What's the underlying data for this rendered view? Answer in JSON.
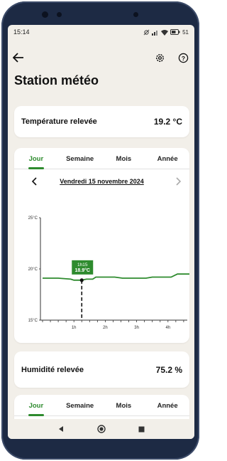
{
  "status_bar": {
    "time": "15:14",
    "battery": "51"
  },
  "page": {
    "title": "Station météo"
  },
  "temperature": {
    "label": "Température relevée",
    "value": "19.2 °C"
  },
  "tabs": [
    "Jour",
    "Semaine",
    "Mois",
    "Année"
  ],
  "active_tab": "Jour",
  "date_nav": {
    "date": "Vendredi 15 novembre 2024"
  },
  "chart_data": {
    "type": "line",
    "ylim": [
      15,
      25
    ],
    "yticks": [
      "25°C",
      "20°C",
      "15°C"
    ],
    "xticks": [
      "1h",
      "2h",
      "3h",
      "4h"
    ],
    "x_hours": [
      0,
      0.5,
      0.9,
      1.0,
      1.25,
      1.4,
      1.6,
      1.7,
      2.0,
      2.3,
      2.55,
      2.7,
      3.0,
      3.3,
      3.5,
      3.6,
      3.9,
      4.1,
      4.3,
      4.4,
      4.7,
      4.9
    ],
    "values": [
      19.1,
      19.1,
      19.0,
      18.9,
      18.9,
      19.0,
      19.0,
      19.2,
      19.2,
      19.2,
      19.1,
      19.1,
      19.1,
      19.1,
      19.2,
      19.2,
      19.2,
      19.2,
      19.5,
      19.5,
      19.5,
      19.3
    ],
    "series_color": "#2e8b2e",
    "marker": {
      "time": "1h15",
      "value": "18.9°C",
      "x_hour": 1.25,
      "y": 18.9
    }
  },
  "humidity": {
    "label": "Humidité relevée",
    "value": "75.2 %"
  },
  "icons": {
    "back": "arrow-left-icon",
    "settings": "gear-icon",
    "help": "question-icon"
  }
}
